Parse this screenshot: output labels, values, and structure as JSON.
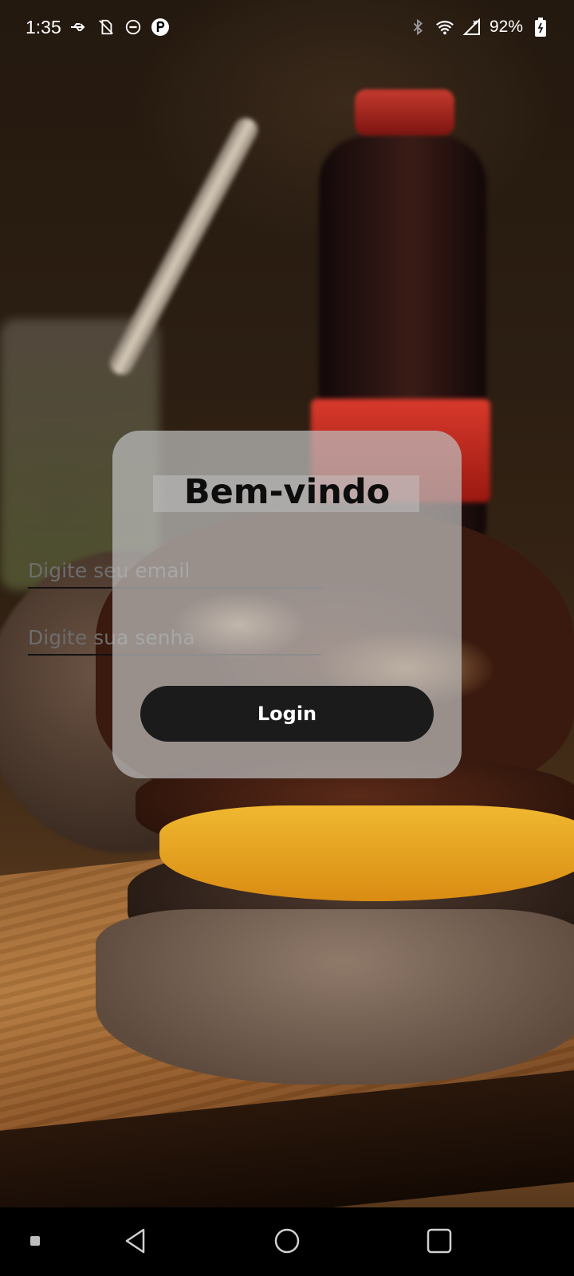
{
  "status_bar": {
    "time": "1:35",
    "battery_percent": "92%",
    "icons": [
      "usb-icon",
      "no-sim-icon",
      "do-not-disturb-icon",
      "app-notification-icon",
      "bluetooth-icon",
      "wifi-icon",
      "cell-signal-icon",
      "battery-icon"
    ]
  },
  "background": {
    "description_icon": "burger-photo"
  },
  "login_card": {
    "title": "Bem-vindo",
    "email_placeholder": "Digite seu email",
    "email_value": "",
    "password_placeholder": "Digite sua senha",
    "password_value": "",
    "login_label": "Login"
  },
  "nav_bar": {
    "buttons": [
      "back-icon",
      "home-icon",
      "recents-icon"
    ]
  },
  "colors": {
    "card_background": "#bebebe",
    "button_background": "#1b1b1b",
    "button_text": "#ffffff",
    "title_text": "#0d0d0d"
  }
}
